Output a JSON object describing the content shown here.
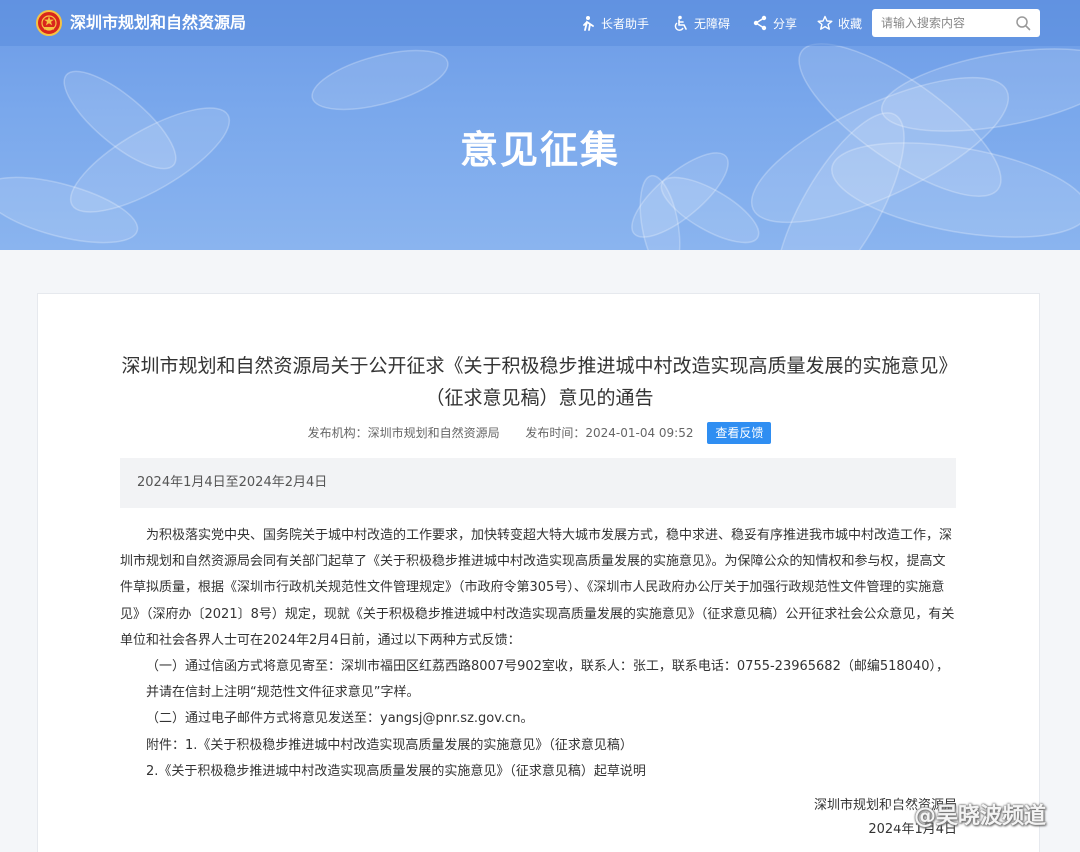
{
  "header": {
    "site_name": "深圳市规划和自然资源局",
    "tools": {
      "assist": "长者助手",
      "accessibility": "无障碍",
      "share": "分享",
      "favorite": "收藏"
    },
    "search": {
      "placeholder": "请输入搜索内容"
    }
  },
  "banner": {
    "title": "意见征集"
  },
  "article": {
    "title": "深圳市规划和自然资源局关于公开征求《关于积极稳步推进城中村改造实现高质量发展的实施意见》（征求意见稿）意见的通告",
    "meta": {
      "publisher": "发布机构：深圳市规划和自然资源局",
      "time": "发布时间：2024-01-04 09:52",
      "feedback_button": "查看反馈"
    },
    "period": "2024年1月4日至2024年2月4日",
    "paragraphs": [
      "为积极落实党中央、国务院关于城中村改造的工作要求，加快转变超大特大城市发展方式，稳中求进、稳妥有序推进我市城中村改造工作，深圳市规划和自然资源局会同有关部门起草了《关于积极稳步推进城中村改造实现高质量发展的实施意见》。为保障公众的知情权和参与权，提高文件草拟质量，根据《深圳市行政机关规范性文件管理规定》（市政府令第305号）、《深圳市人民政府办公厅关于加强行政规范性文件管理的实施意见》（深府办〔2021〕8号）规定，现就《关于积极稳步推进城中村改造实现高质量发展的实施意见》（征求意见稿）公开征求社会公众意见，有关单位和社会各界人士可在2024年2月4日前，通过以下两种方式反馈：",
      "（一）通过信函方式将意见寄至：深圳市福田区红荔西路8007号902室收，联系人：张工，联系电话：0755-23965682（邮编518040），并请在信封上注明“规范性文件征求意见”字样。",
      "（二）通过电子邮件方式将意见发送至：yangsj@pnr.sz.gov.cn。",
      "附件：1.《关于积极稳步推进城中村改造实现高质量发展的实施意见》（征求意见稿）",
      "2.《关于积极稳步推进城中村改造实现高质量发展的实施意见》（征求意见稿）起草说明"
    ],
    "signature": {
      "org": "深圳市规划和自然资源局",
      "date": "2024年1月4日"
    }
  },
  "watermark": "@吴晓波频道",
  "colors": {
    "banner": "#7aa8ec",
    "accent": "#2f8ef2",
    "period_bg": "#f2f3f5"
  },
  "icons": [
    "national-emblem-icon",
    "elder-assist-icon",
    "accessibility-icon",
    "share-icon",
    "star-icon",
    "search-icon"
  ]
}
